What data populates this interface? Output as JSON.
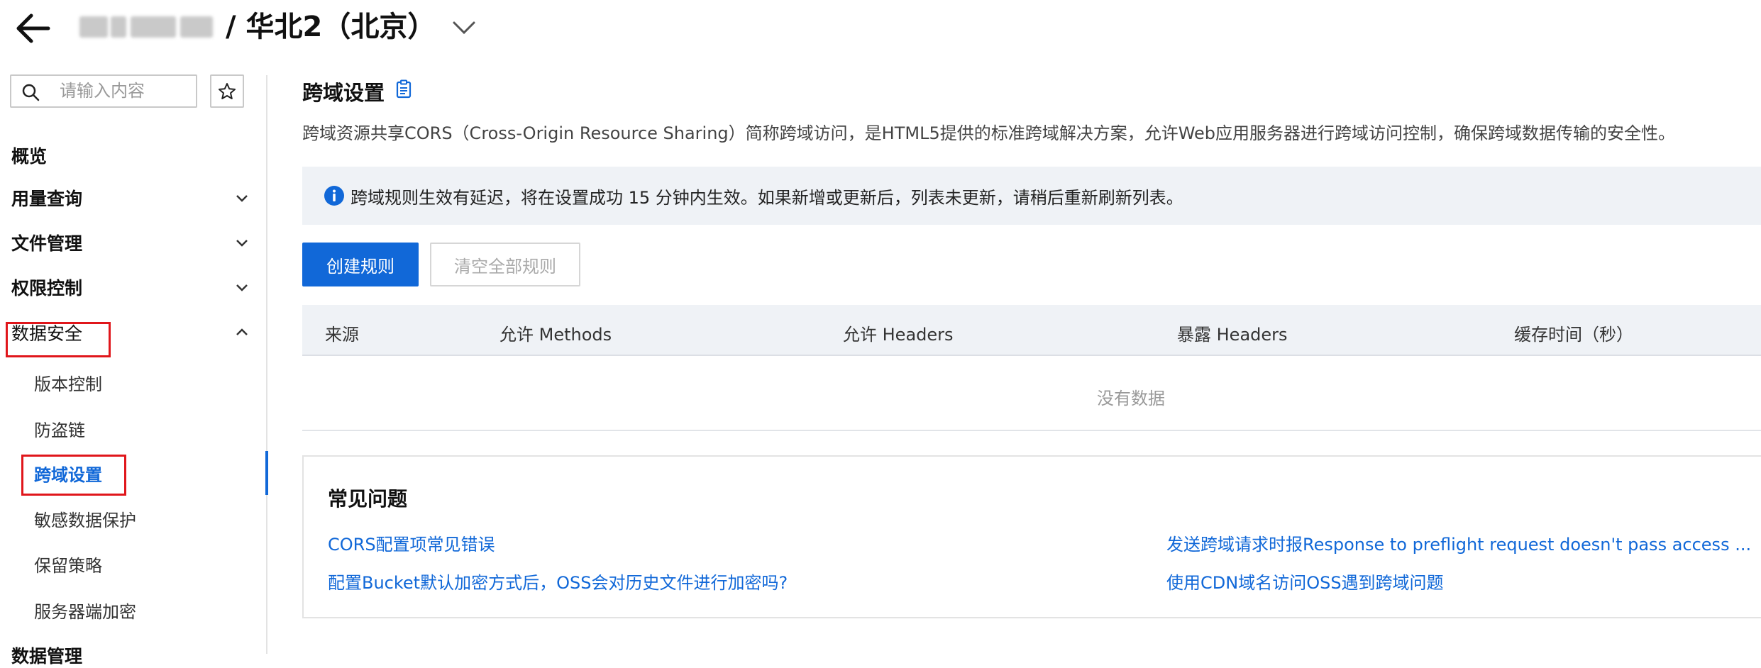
{
  "header": {
    "region_title": "/ 华北2（北京）"
  },
  "sidebar": {
    "search_placeholder": "请输入内容",
    "nav": [
      {
        "label": "概览"
      },
      {
        "label": "用量查询"
      },
      {
        "label": "文件管理"
      },
      {
        "label": "权限控制"
      },
      {
        "label": "数据安全"
      }
    ],
    "sub_items": [
      {
        "label": "版本控制"
      },
      {
        "label": "防盗链"
      },
      {
        "label": "跨域设置"
      },
      {
        "label": "敏感数据保护"
      },
      {
        "label": "保留策略"
      },
      {
        "label": "服务器端加密"
      }
    ],
    "next_group": "数据管理"
  },
  "main": {
    "title": "跨域设置",
    "description": "跨域资源共享CORS（Cross-Origin Resource Sharing）简称跨域访问，是HTML5提供的标准跨域解决方案，允许Web应用服务器进行跨域访问控制，确保跨域数据传输的安全性。",
    "notice": "跨域规则生效有延迟，将在设置成功 15 分钟内生效。如果新增或更新后，列表未更新，请稍后重新刷新列表。",
    "buttons": {
      "create": "创建规则",
      "clear_all": "清空全部规则"
    },
    "table": {
      "headers": [
        "来源",
        "允许 Methods",
        "允许 Headers",
        "暴露 Headers",
        "缓存时间（秒）"
      ],
      "empty_text": "没有数据"
    },
    "faq": {
      "title": "常见问题",
      "links": [
        "CORS配置项常见错误",
        "发送跨域请求时报Response to preflight request doesn't pass access ...",
        "配置Bucket默认加密方式后，OSS会对历史文件进行加密吗?",
        "使用CDN域名访问OSS遇到跨域问题"
      ]
    }
  },
  "colors": {
    "primary": "#1168d8",
    "highlight_box": "#e0161b",
    "notice_bg": "#eff2f6"
  }
}
